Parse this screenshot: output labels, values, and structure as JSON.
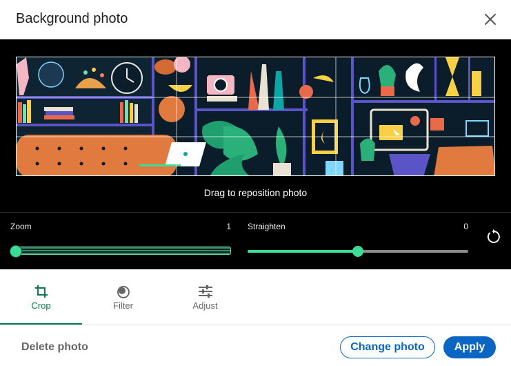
{
  "dialog": {
    "title": "Background photo",
    "close_icon": "close-icon"
  },
  "preview": {
    "hint": "Drag to reposition photo"
  },
  "controls": {
    "zoom": {
      "label": "Zoom",
      "value": "1",
      "level": 0
    },
    "straighten": {
      "label": "Straighten",
      "value": "0",
      "level": 0.5
    },
    "reset_icon": "rotate-reset-icon"
  },
  "tabs": [
    {
      "label": "Crop",
      "icon": "crop-icon",
      "active": true
    },
    {
      "label": "Filter",
      "icon": "filter-icon",
      "active": false
    },
    {
      "label": "Adjust",
      "icon": "adjust-sliders-icon",
      "active": false
    }
  ],
  "footer": {
    "delete_label": "Delete photo",
    "change_label": "Change photo",
    "apply_label": "Apply"
  },
  "colors": {
    "accent_green": "#3ddc97",
    "tab_active": "#0a7a4a",
    "primary_blue": "#0a66c2",
    "banner_bg": "#0b1d2a"
  }
}
